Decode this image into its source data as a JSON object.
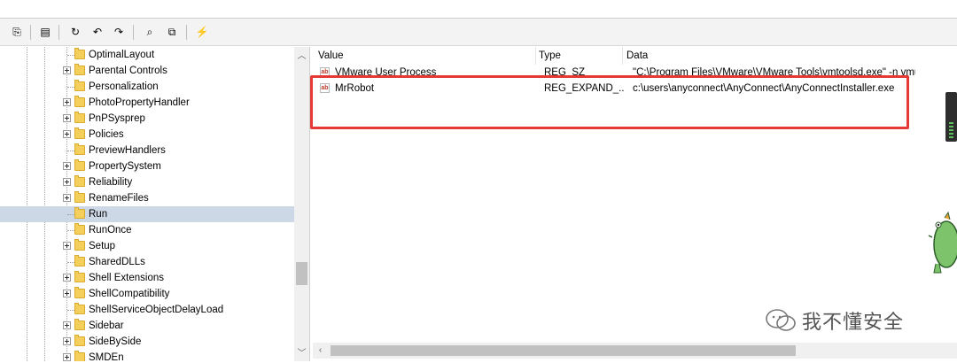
{
  "toolbar": {
    "buttons": [
      {
        "name": "copy-icon",
        "glyph": "⎘"
      },
      {
        "name": "properties-icon",
        "glyph": "▤"
      },
      {
        "name": "refresh-icon",
        "glyph": "↻"
      },
      {
        "name": "back-icon",
        "glyph": "↶"
      },
      {
        "name": "forward-icon",
        "glyph": "↷"
      },
      {
        "name": "find-icon",
        "glyph": "⌕"
      },
      {
        "name": "export-icon",
        "glyph": "⧉"
      },
      {
        "name": "jump-icon",
        "glyph": "⚡"
      }
    ]
  },
  "tree": {
    "items": [
      {
        "label": "OptimalLayout",
        "expandable": false,
        "selected": false
      },
      {
        "label": "Parental Controls",
        "expandable": true,
        "selected": false
      },
      {
        "label": "Personalization",
        "expandable": false,
        "selected": false
      },
      {
        "label": "PhotoPropertyHandler",
        "expandable": true,
        "selected": false
      },
      {
        "label": "PnPSysprep",
        "expandable": true,
        "selected": false
      },
      {
        "label": "Policies",
        "expandable": true,
        "selected": false
      },
      {
        "label": "PreviewHandlers",
        "expandable": false,
        "selected": false
      },
      {
        "label": "PropertySystem",
        "expandable": true,
        "selected": false
      },
      {
        "label": "Reliability",
        "expandable": true,
        "selected": false
      },
      {
        "label": "RenameFiles",
        "expandable": true,
        "selected": false
      },
      {
        "label": "Run",
        "expandable": false,
        "selected": true
      },
      {
        "label": "RunOnce",
        "expandable": false,
        "selected": false
      },
      {
        "label": "Setup",
        "expandable": true,
        "selected": false
      },
      {
        "label": "SharedDLLs",
        "expandable": false,
        "selected": false
      },
      {
        "label": "Shell Extensions",
        "expandable": true,
        "selected": false
      },
      {
        "label": "ShellCompatibility",
        "expandable": true,
        "selected": false
      },
      {
        "label": "ShellServiceObjectDelayLoad",
        "expandable": false,
        "selected": false
      },
      {
        "label": "Sidebar",
        "expandable": true,
        "selected": false
      },
      {
        "label": "SideBySide",
        "expandable": true,
        "selected": false
      },
      {
        "label": "SMDEn",
        "expandable": true,
        "selected": false
      }
    ]
  },
  "list": {
    "columns": {
      "value": "Value",
      "type": "Type",
      "data": "Data"
    },
    "rows": [
      {
        "name": "VMware User Process",
        "type": "REG_SZ",
        "data": "\"C:\\Program Files\\VMware\\VMware Tools\\vmtoolsd.exe\" -n vmusr"
      },
      {
        "name": "MrRobot",
        "type": "REG_EXPAND_...",
        "data": "c:\\users\\anyconnect\\AnyConnect\\AnyConnectInstaller.exe"
      }
    ],
    "icon_text": "ab"
  },
  "scroll": {
    "up": "︿",
    "down": "﹀",
    "left": "‹",
    "right": "›"
  },
  "watermark": {
    "text": "我不懂安全"
  },
  "colors": {
    "highlight_box": "#e53935",
    "selection": "#cdd8e6"
  }
}
